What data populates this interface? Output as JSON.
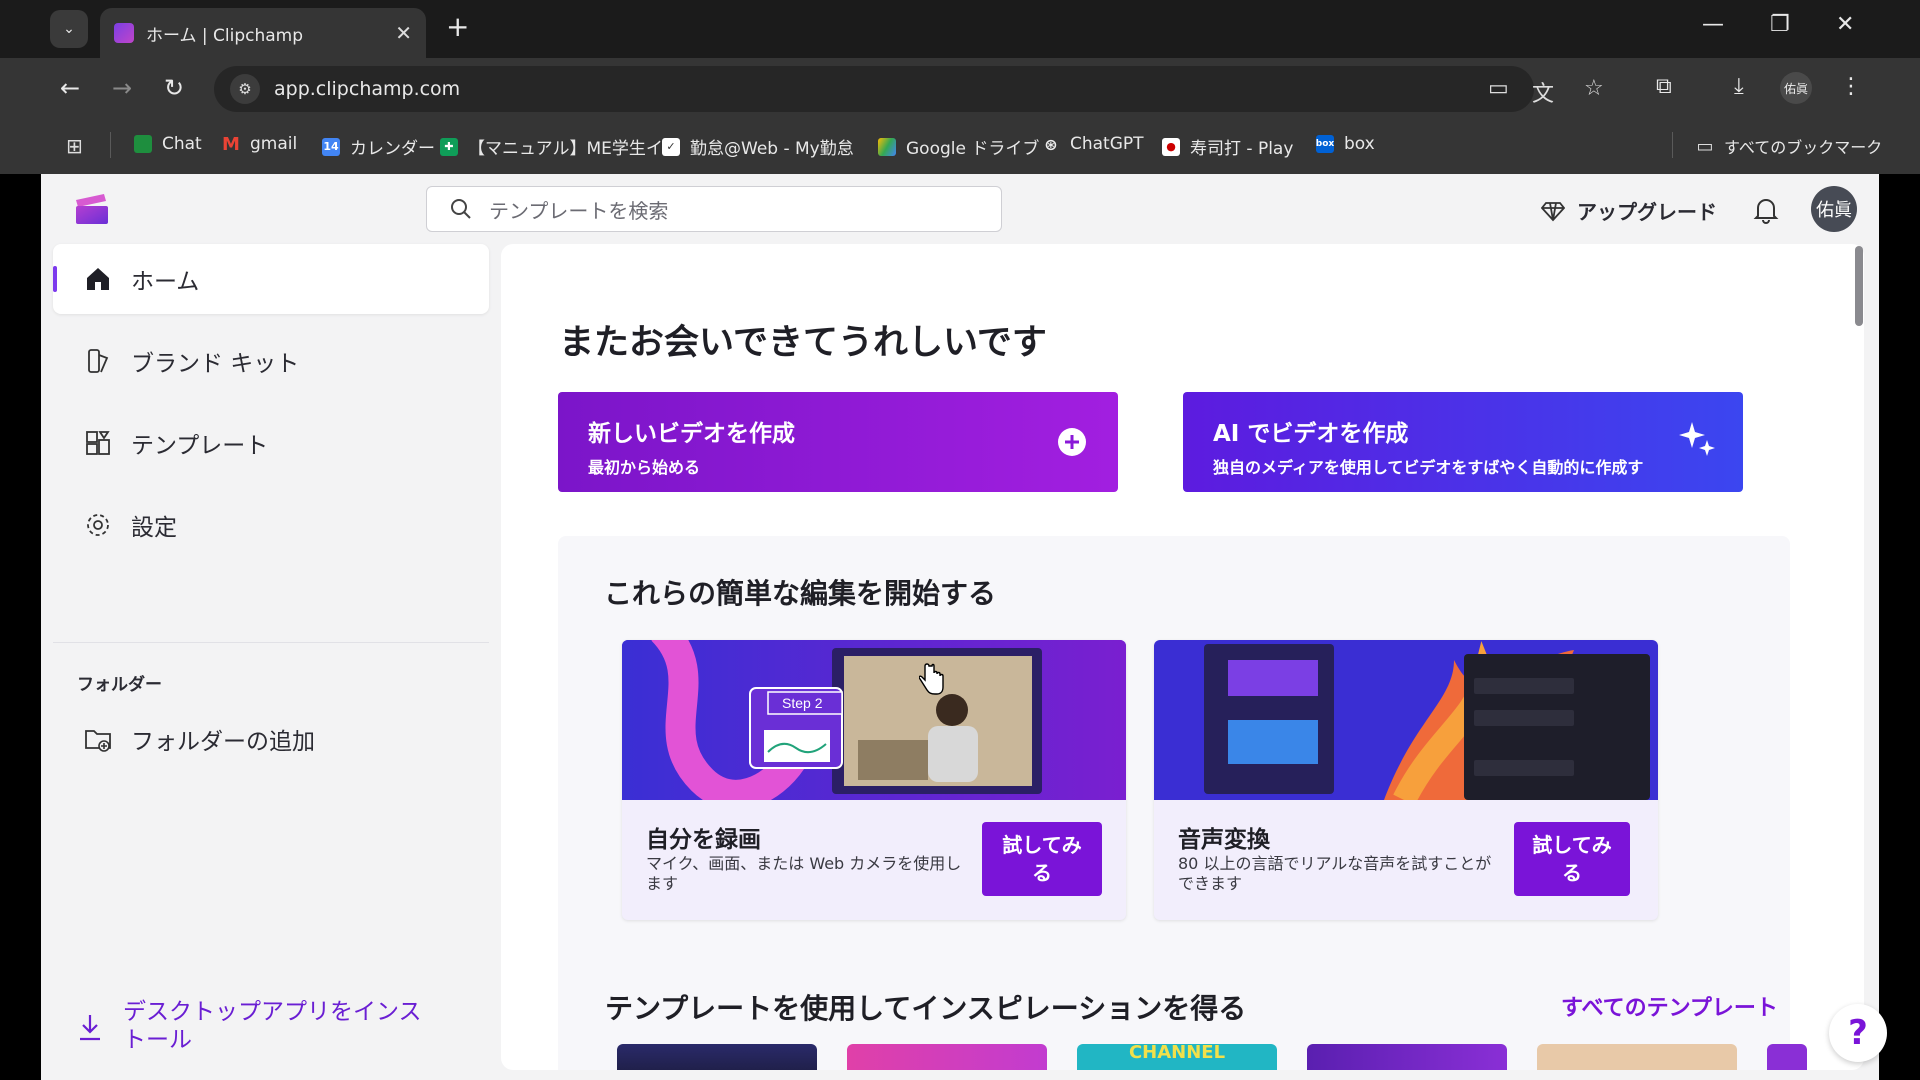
{
  "browser": {
    "tab_title": "ホーム | Clipchamp",
    "url": "app.clipchamp.com",
    "profile_label": "佑眞",
    "bookmarks": [
      {
        "label": "Chat",
        "icon": "google-chat-icon"
      },
      {
        "label": "gmail",
        "icon": "gmail-icon"
      },
      {
        "label": "カレンダー",
        "icon": "calendar-icon"
      },
      {
        "label": "【マニュアル】ME学生イ...",
        "icon": "sheet-icon"
      },
      {
        "label": "勤怠@Web - My勤怠",
        "icon": "check-icon"
      },
      {
        "label": "Google ドライブ",
        "icon": "drive-icon"
      },
      {
        "label": "ChatGPT",
        "icon": "chatgpt-icon"
      },
      {
        "label": "寿司打 - Play",
        "icon": "sushida-icon"
      },
      {
        "label": "box",
        "icon": "box-icon"
      }
    ],
    "all_bookmarks": "すべてのブックマーク"
  },
  "header": {
    "search_placeholder": "テンプレートを検索",
    "upgrade": "アップグレード",
    "avatar": "佑眞"
  },
  "sidebar": {
    "items": [
      {
        "label": "ホーム",
        "icon": "home-icon",
        "active": true
      },
      {
        "label": "ブランド キット",
        "icon": "brand-kit-icon",
        "active": false
      },
      {
        "label": "テンプレート",
        "icon": "templates-icon",
        "active": false
      },
      {
        "label": "設定",
        "icon": "settings-icon",
        "active": false
      }
    ],
    "folders_heading": "フォルダー",
    "add_folder": "フォルダーの追加",
    "install": "デスクトップアプリをインストール"
  },
  "main": {
    "welcome": "またお会いできてうれしいです",
    "cta_new": {
      "title": "新しいビデオを作成",
      "subtitle": "最初から始める"
    },
    "cta_ai": {
      "title": "AI でビデオを作成",
      "subtitle": "独自のメディアを使用してビデオをすばやく自動的に作成す"
    },
    "edits_heading": "これらの簡単な編集を開始する",
    "cards": [
      {
        "title": "自分を録画",
        "description": "マイク、画面、または Web カメラを使用します",
        "button": "試してみる",
        "image_label": "Step 2"
      },
      {
        "title": "音声変換",
        "description": "80 以上の言語でリアルな音声を試すことができます",
        "button": "試してみる"
      }
    ],
    "templates_heading": "テンプレートを使用してインスピレーションを得る",
    "all_templates": "すべてのテンプレート",
    "template_thumb_text": "CHANNEL",
    "help": "?"
  },
  "colors": {
    "accent": "#7a14d8",
    "browser_bg": "#353535",
    "app_bg": "#f3f3f4"
  }
}
